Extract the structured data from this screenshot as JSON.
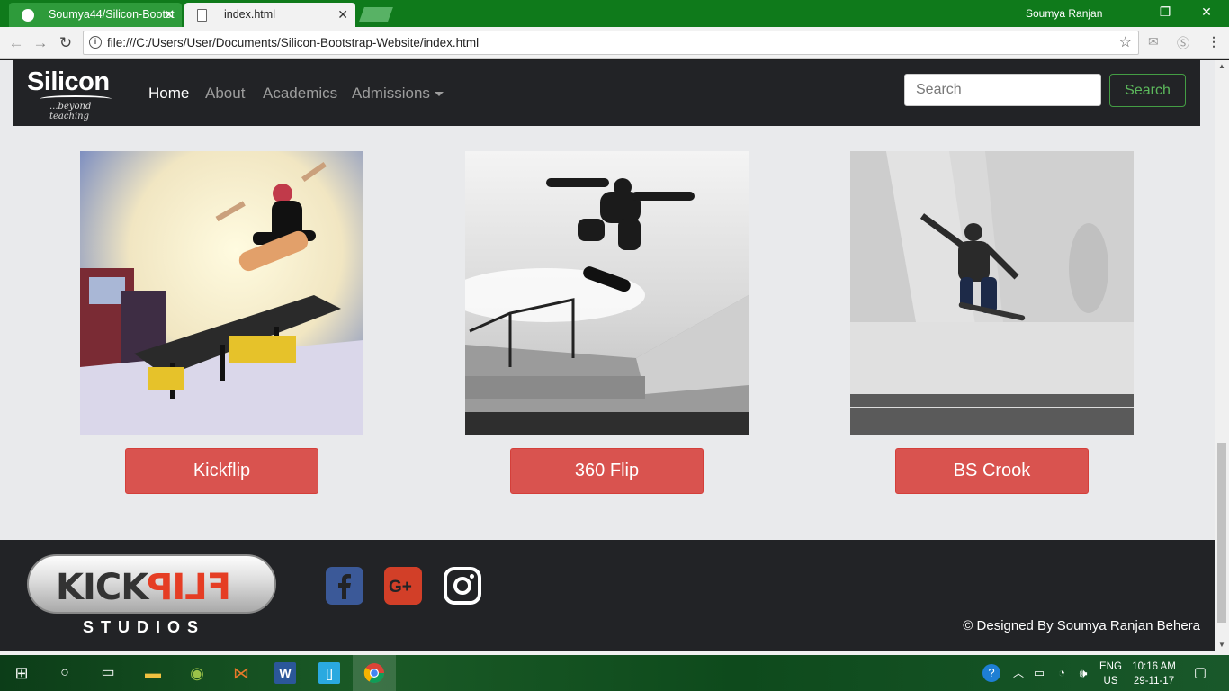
{
  "browser": {
    "tabs": [
      {
        "label": "Soumya44/Silicon-Bootst",
        "icon": "github-icon"
      },
      {
        "label": "index.html",
        "icon": "document-icon"
      }
    ],
    "user": "Soumya Ranjan",
    "url": "file:///C:/Users/User/Documents/Silicon-Bootstrap-Website/index.html",
    "window_controls": {
      "minimize": "—",
      "restore": "❐",
      "close": "✕"
    }
  },
  "navbar": {
    "logo_main": "Silicon",
    "logo_sub": "...beyond teaching",
    "links": [
      "Home",
      "About",
      "Academics",
      "Admissions"
    ],
    "search_placeholder": "Search",
    "search_button": "Search"
  },
  "cards": [
    {
      "button": "Kickflip",
      "image": "skateboarder-kickflip-photo"
    },
    {
      "button": "360 Flip",
      "image": "skateboarder-360-flip-photo"
    },
    {
      "button": "BS Crook",
      "image": "skateboarder-bs-crook-photo"
    }
  ],
  "footer": {
    "logo_kick": "KICK",
    "logo_flip": "FLIP",
    "logo_studios": "STUDIOS",
    "social": [
      "facebook-icon",
      "google-plus-icon",
      "instagram-icon"
    ],
    "credits": "© Designed By Soumya Ranjan Behera"
  },
  "taskbar": {
    "language": "ENG",
    "region": "US",
    "time": "10:16 AM",
    "date": "29-11-17"
  },
  "colors": {
    "navbar_bg": "#222326",
    "page_bg": "#e9eaec",
    "danger": "#d9534f",
    "success": "#5cb85c",
    "titlebar": "#0f7a1b"
  }
}
